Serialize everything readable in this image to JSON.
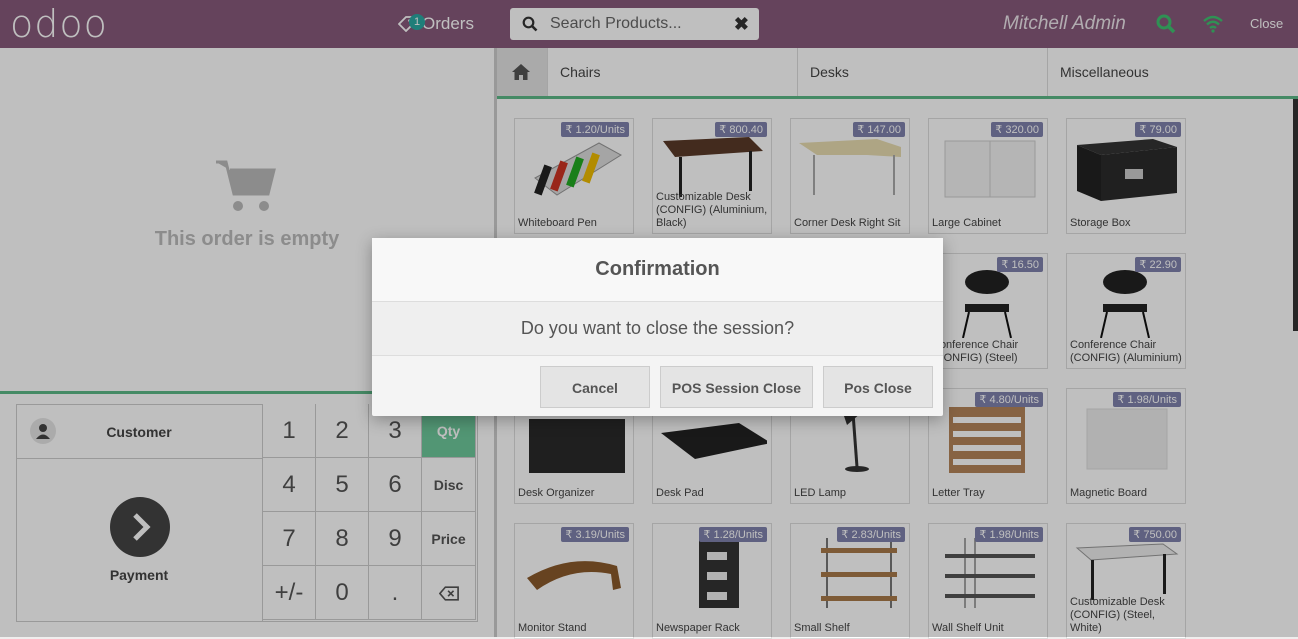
{
  "header": {
    "logo": "odoo",
    "orders_label": "Orders",
    "orders_count": "1",
    "search_placeholder": "Search Products...",
    "user": "Mitchell Admin",
    "close_label": "Close"
  },
  "order": {
    "empty_text": "This order is empty"
  },
  "numpad": {
    "customer_label": "Customer",
    "payment_label": "Payment",
    "keys": [
      "1",
      "2",
      "3",
      "4",
      "5",
      "6",
      "7",
      "8",
      "9",
      "+/-",
      "0",
      "."
    ],
    "modes": [
      "Qty",
      "Disc",
      "Price"
    ],
    "selected_mode": "Qty"
  },
  "categories": [
    "Chairs",
    "Desks",
    "Miscellaneous"
  ],
  "products": [
    {
      "name": "Whiteboard Pen",
      "price": "₹ 1.20/Units"
    },
    {
      "name": "Customizable Desk (CONFIG) (Aluminium, Black)",
      "price": "₹ 800.40"
    },
    {
      "name": "Corner Desk Right Sit",
      "price": "₹ 147.00"
    },
    {
      "name": "Large Cabinet",
      "price": "₹ 320.00"
    },
    {
      "name": "Storage Box",
      "price": "₹ 79.00"
    },
    {
      "name": "Conference Chair (CONFIG) (Steel)",
      "price": "₹ 16.50"
    },
    {
      "name": "Conference Chair (CONFIG) (Aluminium)",
      "price": "₹ 22.90"
    },
    {
      "name": "Desk Organizer",
      "price": ""
    },
    {
      "name": "Desk Pad",
      "price": ""
    },
    {
      "name": "LED Lamp",
      "price": ""
    },
    {
      "name": "Letter Tray",
      "price": "₹ 4.80/Units"
    },
    {
      "name": "Magnetic Board",
      "price": "₹ 1.98/Units"
    },
    {
      "name": "Monitor Stand",
      "price": "₹ 3.19/Units"
    },
    {
      "name": "Newspaper Rack",
      "price": "₹ 1.28/Units"
    },
    {
      "name": "Small Shelf",
      "price": "₹ 2.83/Units"
    },
    {
      "name": "Wall Shelf Unit",
      "price": "₹ 1.98/Units"
    },
    {
      "name": "Customizable Desk (CONFIG) (Steel, White)",
      "price": "₹ 750.00"
    }
  ],
  "dialog": {
    "title": "Confirmation",
    "message": "Do you want to close the session?",
    "cancel": "Cancel",
    "session_close": "POS Session Close",
    "pos_close": "Pos Close"
  },
  "colors": {
    "header": "#875a7b",
    "accent_green": "#5cb887",
    "price_tag": "#7f82ac"
  }
}
